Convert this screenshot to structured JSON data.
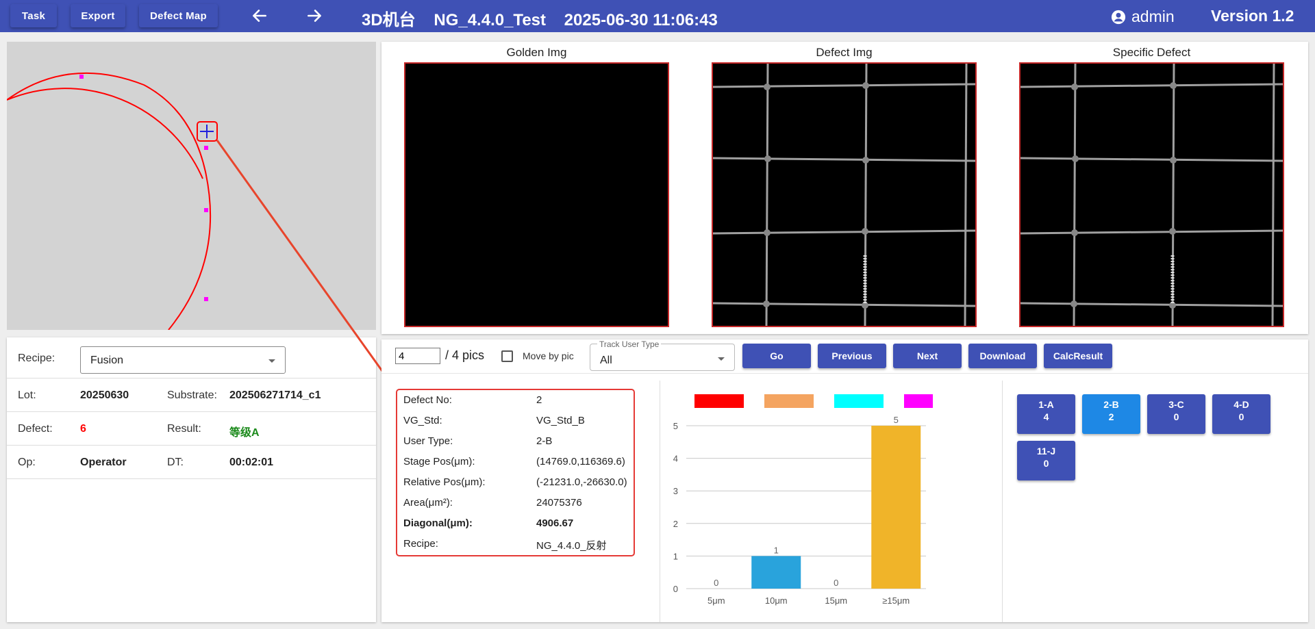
{
  "header": {
    "buttons": [
      "Task",
      "Export",
      "Defect Map"
    ],
    "machine": "3D机台",
    "recipe_name": "NG_4.4.0_Test",
    "datetime": "2025-06-30 11:06:43",
    "user": "admin",
    "version": "Version 1.2",
    "color": "#3f51b5"
  },
  "info": {
    "recipe_label": "Recipe:",
    "recipe_value": "Fusion",
    "lot_label": "Lot:",
    "lot_value": "20250630",
    "substrate_label": "Substrate:",
    "substrate_value": "202506271714_c1",
    "defect_label": "Defect:",
    "defect_value": "6",
    "result_label": "Result:",
    "result_value": "等级A",
    "op_label": "Op:",
    "op_value": "Operator",
    "dt_label": "DT:",
    "dt_value": "00:02:01"
  },
  "images": {
    "golden": "Golden Img",
    "defect": "Defect Img",
    "specific": "Specific Defect"
  },
  "controls": {
    "page_value": "4",
    "pics_text": "/ 4 pics",
    "move_by_pic": "Move by pic",
    "track_user_type_label": "Track User Type",
    "track_user_type_value": "All",
    "buttons": [
      "Go",
      "Previous",
      "Next",
      "Download",
      "CalcResult"
    ]
  },
  "detail": [
    {
      "k": "Defect No:",
      "v": "2"
    },
    {
      "k": "VG_Std:",
      "v": "VG_Std_B"
    },
    {
      "k": "User Type:",
      "v": "2-B"
    },
    {
      "k": "Stage Pos(μm):",
      "v": "(14769.0,116369.6)"
    },
    {
      "k": "Relative Pos(μm):",
      "v": "(-21231.0,-26630.0)"
    },
    {
      "k": "Area(μm²):",
      "v": "24075376"
    },
    {
      "k": "Diagonal(μm):",
      "v": "4906.67"
    },
    {
      "k": "Recipe:",
      "v": "NG_4.4.0_反射"
    }
  ],
  "chart_data": {
    "type": "bar",
    "categories": [
      "5μm",
      "10μm",
      "15μm",
      "≥15μm"
    ],
    "values": [
      0,
      1,
      0,
      5
    ],
    "bar_colors": [
      "#e53935",
      "#29a3dc",
      "#e53935",
      "#f0b429"
    ],
    "legend_colors": [
      "#ff0000",
      "#f4a460",
      "#00ffff",
      "#ff00ff"
    ],
    "ylim": [
      0,
      5
    ],
    "yticks": [
      0,
      1,
      2,
      3,
      4,
      5
    ]
  },
  "user_types": [
    {
      "label": "1-A",
      "count": "4",
      "active": false
    },
    {
      "label": "2-B",
      "count": "2",
      "active": true
    },
    {
      "label": "3-C",
      "count": "0",
      "active": false
    },
    {
      "label": "4-D",
      "count": "0",
      "active": false
    },
    {
      "label": "11-J",
      "count": "0",
      "active": false
    }
  ]
}
